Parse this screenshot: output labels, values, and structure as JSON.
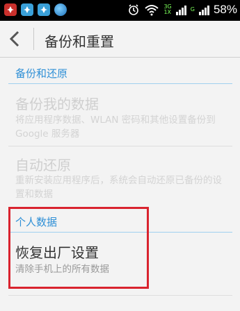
{
  "status_bar": {
    "network_top": "3G",
    "network_bottom": "1X",
    "network_small": "G",
    "battery_percent": "58%"
  },
  "header": {
    "title": "备份和重置"
  },
  "backup_section": {
    "header": "备份和还原",
    "items": [
      {
        "title": "备份我的数据",
        "subtitle": "将应用程序数据、WLAN 密码和其他设置备份到 Google 服务器",
        "enabled": false
      },
      {
        "title": "自动还原",
        "subtitle": "重新安装应用程序后，系统会自动还原已备份的设置和数据",
        "enabled": false
      }
    ]
  },
  "personal_section": {
    "header": "个人数据",
    "items": [
      {
        "title": "恢复出厂设置",
        "subtitle": "清除手机上的所有数据",
        "enabled": true
      }
    ]
  },
  "colors": {
    "accent": "#2e8fd6",
    "highlight": "#d9232e"
  }
}
